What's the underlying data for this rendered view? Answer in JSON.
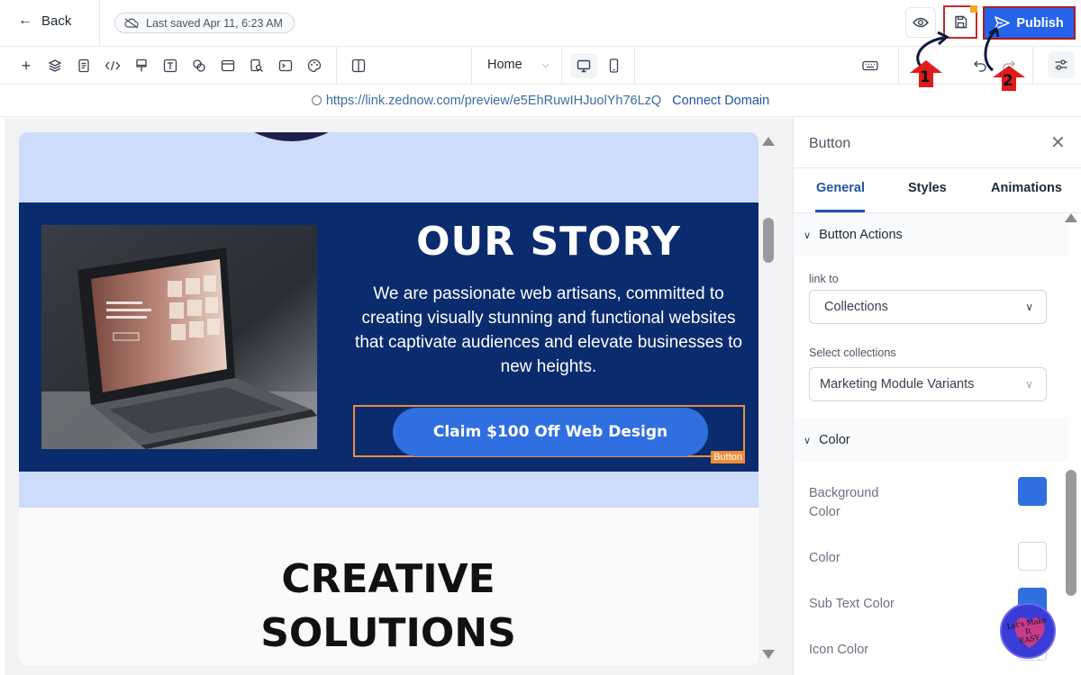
{
  "header": {
    "back_label": "Back",
    "saved_status": "Last saved Apr 11, 6:23 AM",
    "publish_label": "Publish"
  },
  "toolbar": {
    "page_name": "Home"
  },
  "urlbar": {
    "url": "https://link.zednow.com/preview/e5EhRuwIHJuolYh76LzQ",
    "connect_label": "Connect Domain"
  },
  "canvas": {
    "story_title": "OUR STORY",
    "story_text": "We are passionate web artisans, committed to creating visually stunning and functional websites that captivate audiences and elevate businesses to new heights.",
    "cta_label": "Claim $100 Off Web Design",
    "cta_tag": "Button",
    "creative_line1": "CREATIVE",
    "creative_line2": "SOLUTIONS"
  },
  "panel": {
    "title": "Button",
    "tabs": [
      {
        "label": "General",
        "active": true
      },
      {
        "label": "Styles",
        "active": false
      },
      {
        "label": "Animations",
        "active": false
      }
    ],
    "button_actions": {
      "heading": "Button Actions",
      "link_to_label": "link to",
      "link_to_value": "Collections",
      "select_collections_label": "Select collections",
      "select_collections_value": "Marketing Module Variants"
    },
    "color": {
      "heading": "Color",
      "rows": [
        {
          "label_line1": "Background",
          "label_line2": "Color",
          "value": "#2f6fe0"
        },
        {
          "label_line1": "Color",
          "label_line2": "",
          "value": "#ffffff"
        },
        {
          "label_line1": "Sub Text Color",
          "label_line2": "",
          "value": "#2f6fe0"
        },
        {
          "label_line1": "Icon Color",
          "label_line2": "",
          "value": "#ffffff"
        }
      ]
    }
  },
  "annotations": {
    "marker1": "1",
    "marker2": "2",
    "badge_line1": "Let's Make",
    "badge_line2": "It",
    "badge_line3": "EASY"
  },
  "colors": {
    "accent": "#2563eb",
    "annotation_red": "#c62828",
    "story_bg": "#0a2c6e",
    "hero_light": "#cddcfb",
    "selection_orange": "#f08c3a"
  },
  "icons": [
    "arrow-left-icon",
    "cloud-off-icon",
    "eye-icon",
    "save-icon",
    "send-icon",
    "plus-icon",
    "layers-icon",
    "page-icon",
    "code-icon",
    "brush-icon",
    "text-icon",
    "shapes-icon",
    "layout-icon",
    "search-doc-icon",
    "terminal-icon",
    "palette-icon",
    "columns-icon",
    "chevron-down-icon",
    "desktop-icon",
    "mobile-icon",
    "keyboard-icon",
    "undo-icon",
    "redo-icon",
    "sliders-icon",
    "close-icon"
  ]
}
